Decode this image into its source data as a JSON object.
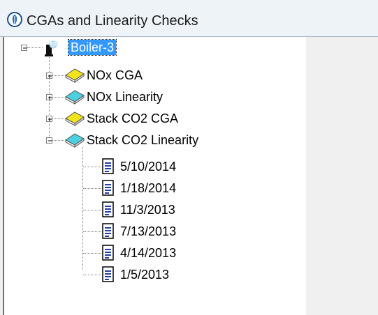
{
  "window": {
    "title": "CGAs and Linearity Checks",
    "icon": "info-circle-icon"
  },
  "tree": {
    "root": {
      "label": "Boiler-3",
      "icon": "boiler-icon",
      "expanded": true,
      "selected": true
    },
    "children": [
      {
        "label": "NOx CGA",
        "icon": "book-yellow-icon",
        "expanded": false
      },
      {
        "label": "NOx Linearity",
        "icon": "book-cyan-icon",
        "expanded": false
      },
      {
        "label": "Stack CO2 CGA",
        "icon": "book-yellow-icon",
        "expanded": false
      },
      {
        "label": "Stack CO2 Linearity",
        "icon": "book-cyan-icon",
        "expanded": true,
        "children": [
          {
            "label": "5/10/2014",
            "icon": "document-icon"
          },
          {
            "label": "1/18/2014",
            "icon": "document-icon"
          },
          {
            "label": "11/3/2013",
            "icon": "document-icon"
          },
          {
            "label": "7/13/2013",
            "icon": "document-icon"
          },
          {
            "label": "4/14/2013",
            "icon": "document-icon"
          },
          {
            "label": "1/5/2013",
            "icon": "document-icon"
          }
        ]
      }
    ]
  },
  "colors": {
    "selection": "#3399ff",
    "book_yellow": "#f2e41c",
    "book_cyan": "#4ad0e0",
    "document_lines": "#1f3fb0"
  }
}
